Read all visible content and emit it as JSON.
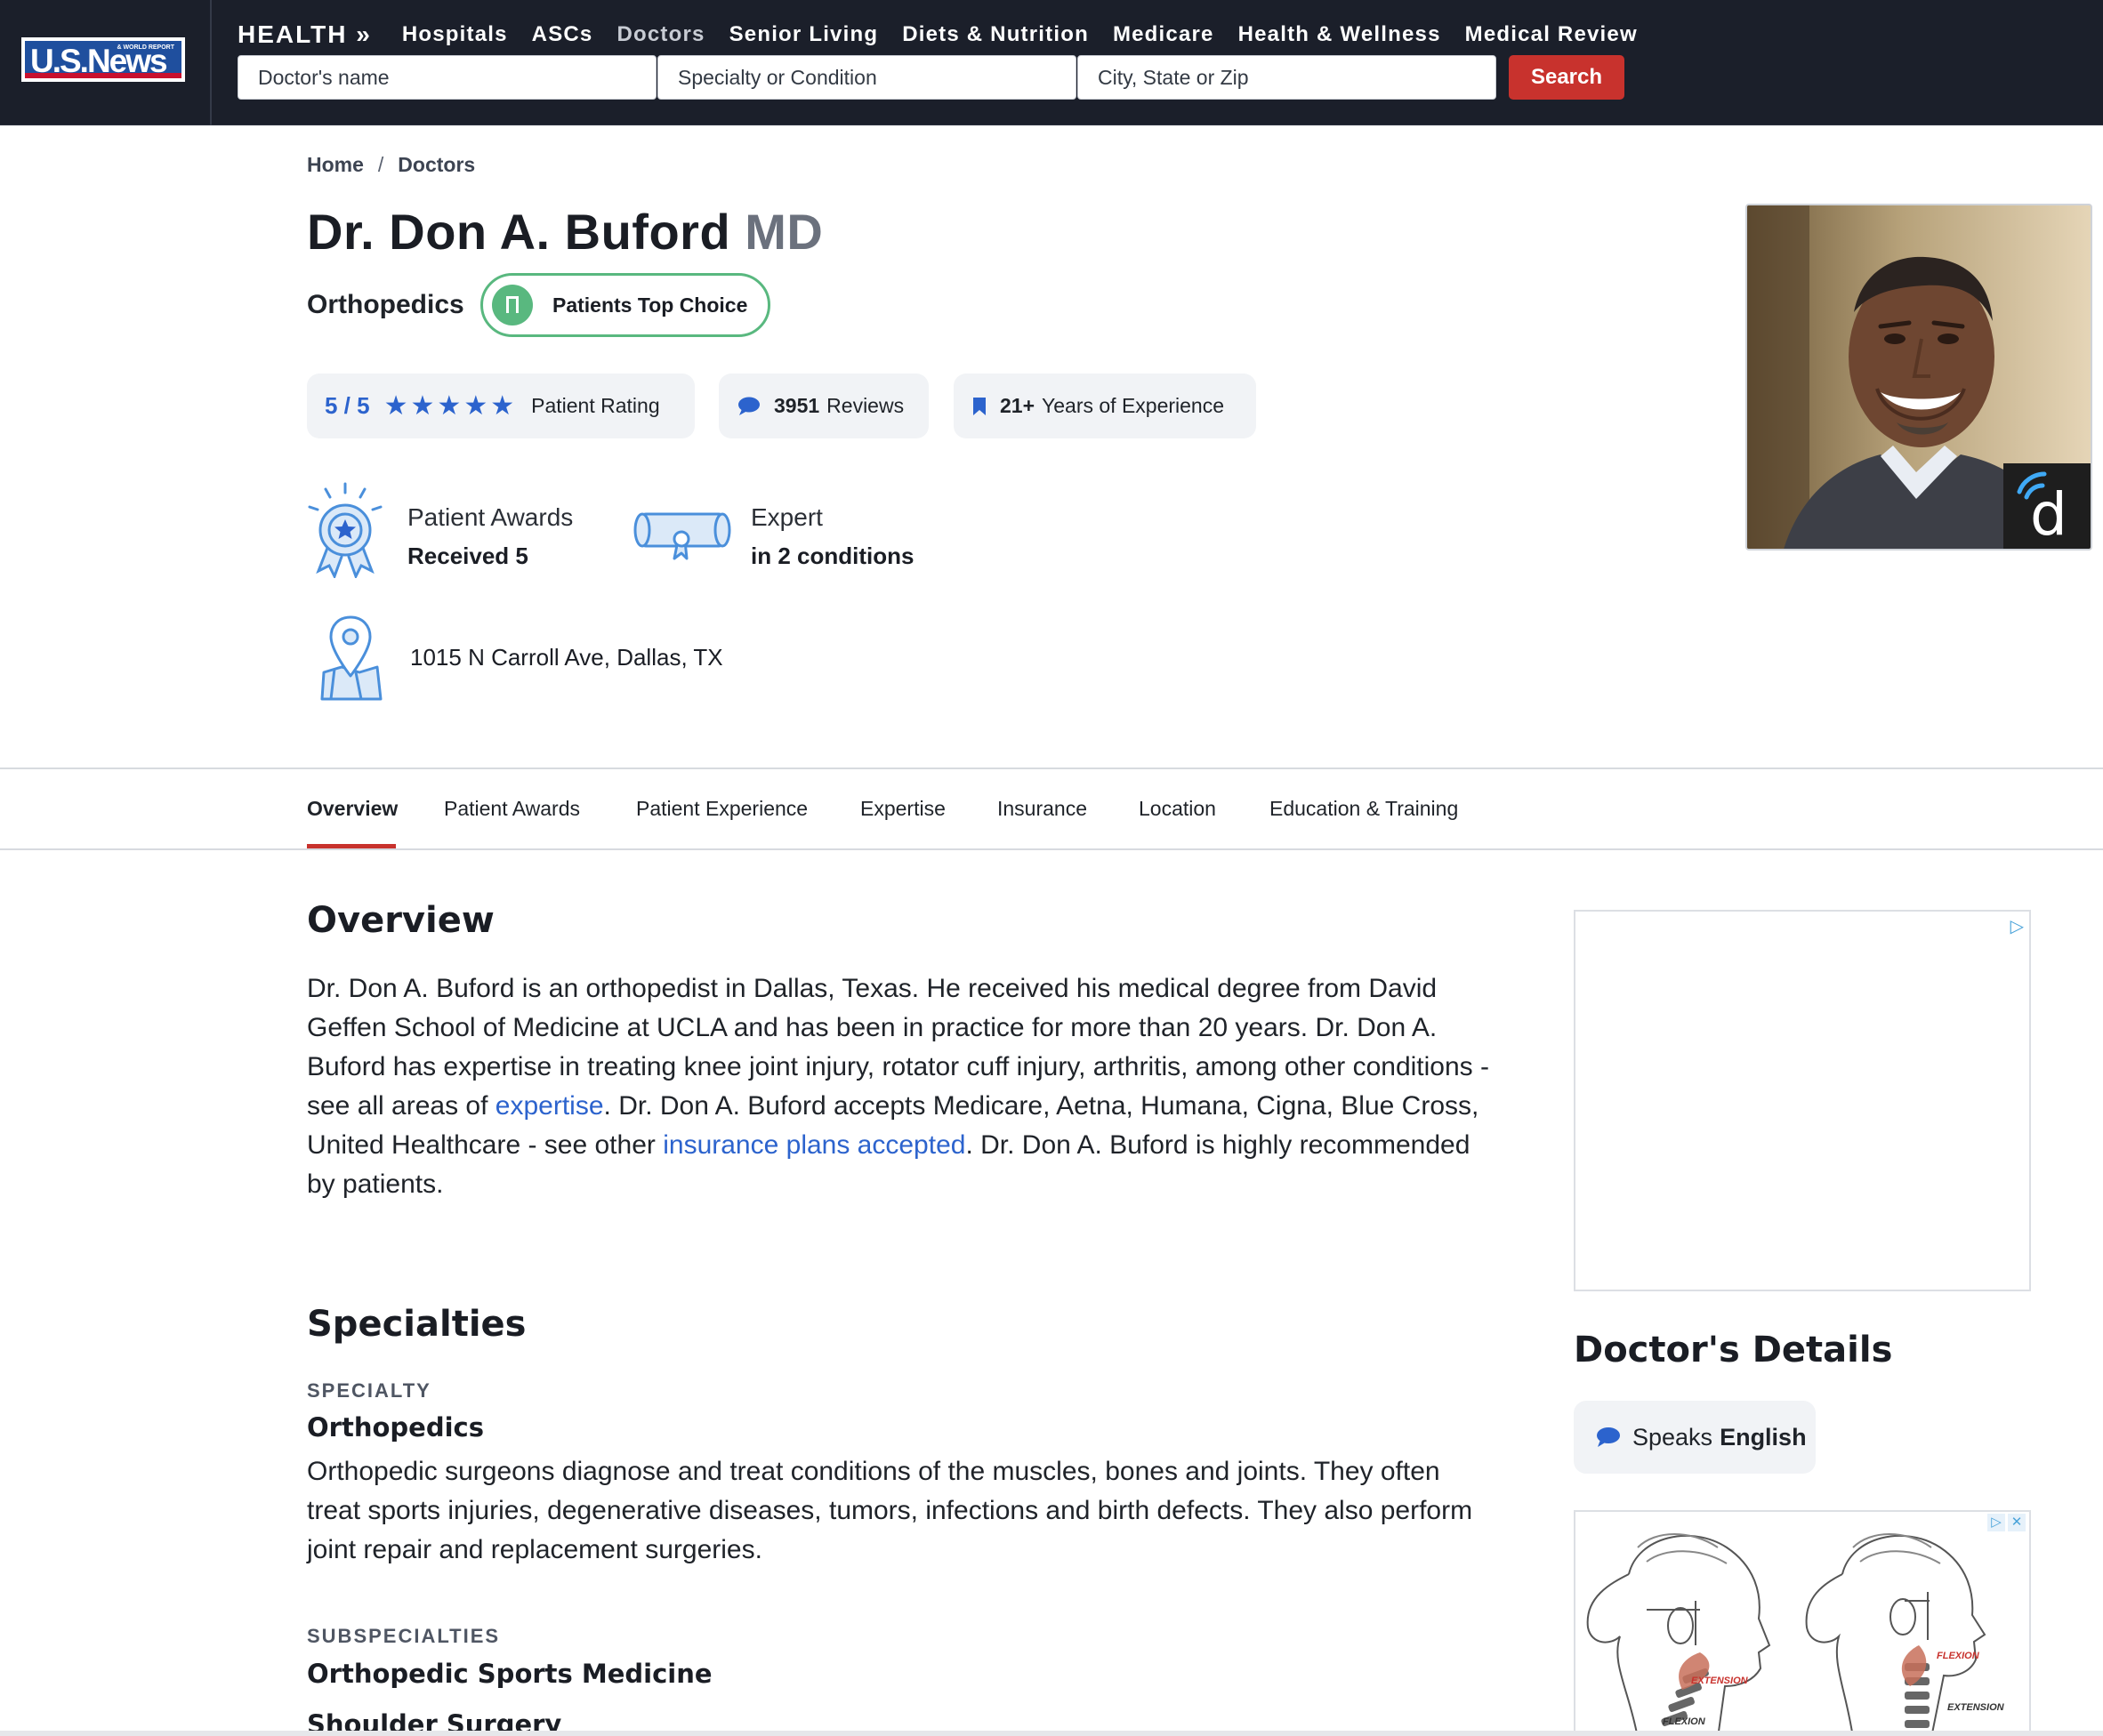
{
  "header": {
    "logo_text": "U.S.News",
    "logo_small_text": "& WORLD REPORT",
    "section": "HEALTH »",
    "nav": [
      "Hospitals",
      "ASCs",
      "Doctors",
      "Senior Living",
      "Diets & Nutrition",
      "Medicare",
      "Health & Wellness",
      "Medical Review"
    ],
    "active_nav": "Doctors",
    "search": {
      "name_placeholder": "Doctor's name",
      "specialty_placeholder": "Specialty or Condition",
      "location_placeholder": "City, State or Zip",
      "button_label": "Search"
    }
  },
  "breadcrumb": [
    "Home",
    "/",
    "Doctors"
  ],
  "doctor": {
    "name": "Dr. Don A. Buford",
    "credential": "MD",
    "specialty": "Orthopedics",
    "badge": "Patients Top Choice",
    "rating_text": "5 / 5",
    "rating_stars": 5,
    "rating_label": "Patient Rating",
    "reviews_count": "3951",
    "reviews_label": "Reviews",
    "experience_value": "21+",
    "experience_label": "Years of Experience",
    "awards_title": "Patient Awards",
    "awards_value": "Received 5",
    "expert_title": "Expert",
    "expert_value": "in 2 conditions",
    "address": "1015 N Carroll Ave, Dallas, TX",
    "photo_badge_letter": "d"
  },
  "tabs": [
    "Overview",
    "Patient Awards",
    "Patient Experience",
    "Expertise",
    "Insurance",
    "Location",
    "Education & Training"
  ],
  "active_tab": "Overview",
  "overview": {
    "heading": "Overview",
    "text_1": "Dr. Don A. Buford is an orthopedist in Dallas, Texas. He received his medical degree from David Geffen School of Medicine at UCLA and has been in practice for more than 20 years. Dr. Don A. Buford has expertise in treating knee joint injury, rotator cuff injury, arthritis, among other conditions - see all areas of ",
    "link_1": "expertise",
    "text_2": ". Dr. Don A. Buford accepts Medicare, Aetna, Humana, Cigna, Blue Cross, United Healthcare - see other ",
    "link_2": "insurance plans accepted",
    "text_3": ". Dr. Don A. Buford is highly recommended by patients."
  },
  "specialties": {
    "heading": "Specialties",
    "specialty_label": "SPECIALTY",
    "specialty_name": "Orthopedics",
    "specialty_description": "Orthopedic surgeons diagnose and treat conditions of the muscles, bones and joints. They often treat sports injuries, degenerative diseases, tumors, infections and birth defects. They also perform joint repair and replacement surgeries.",
    "subspecialties_label": "SUBSPECIALTIES",
    "subspecialties": [
      "Orthopedic Sports Medicine",
      "Shoulder Surgery"
    ]
  },
  "sidebar": {
    "details_heading": "Doctor's Details",
    "speaks_label": "Speaks",
    "speaks_language": "English",
    "ad_captions": [
      "EXTENSION",
      "FLEXION",
      "FLEXION",
      "EXTENSION"
    ]
  },
  "colors": {
    "header_bg": "#1b1f2a",
    "accent_red": "#c8322d",
    "accent_blue": "#2c63cd",
    "badge_green": "#59b87f",
    "chip_bg": "#f1f3f6"
  }
}
